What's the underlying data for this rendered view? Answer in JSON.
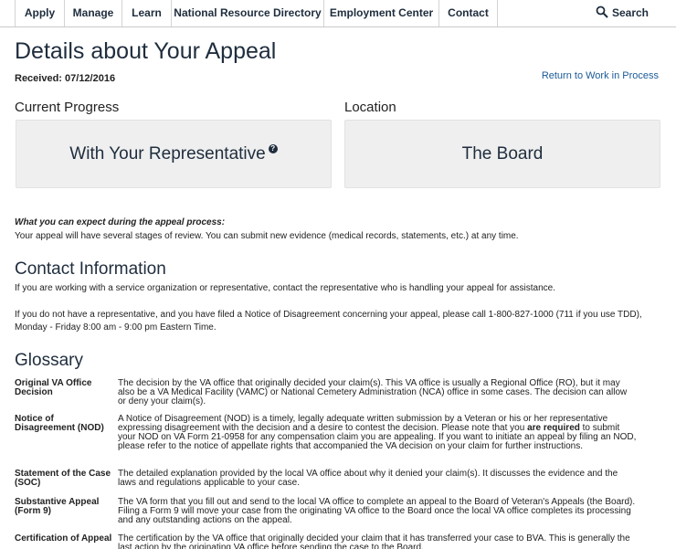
{
  "nav": {
    "items": [
      {
        "label": "Apply"
      },
      {
        "label": "Manage"
      },
      {
        "label": "Learn"
      },
      {
        "label": "National Resource Directory"
      },
      {
        "label": "Employment Center"
      },
      {
        "label": "Contact"
      }
    ],
    "search_label": "Search"
  },
  "page": {
    "title": "Details about Your Appeal",
    "received": "Received: 07/12/2016",
    "return_link": "Return to Work in Process"
  },
  "progress": {
    "heading": "Current Progress",
    "value": "With Your Representative",
    "help_glyph": "?"
  },
  "location": {
    "heading": "Location",
    "value": "The Board"
  },
  "expect": {
    "title": "What you can expect during the appeal process:",
    "text": "Your appeal will have several stages of review. You can submit new evidence (medical records, statements, etc.) at any time."
  },
  "contact": {
    "title": "Contact Information",
    "para1": "If you are working with a service organization or representative, contact the representative who is handling your appeal for assistance.",
    "para2": "If you do not have a representative, and you have filed a Notice of Disagreement concerning your appeal, please call 1-800-827-1000 (711 if you use TDD), Monday - Friday 8:00 am - 9:00 pm Eastern Time."
  },
  "glossary": {
    "title": "Glossary",
    "entries": [
      {
        "term": "Original VA Office Decision",
        "definition": "The decision by the VA office that originally decided your claim(s). This VA office is usually a Regional Office (RO), but it may also be a VA Medical Facility (VAMC) or National Cemetery Administration (NCA) office in some cases. The decision can allow or deny your claim(s)."
      },
      {
        "term": "Notice of Disagreement (NOD)",
        "definition_before": "A Notice of Disagreement (NOD) is a timely, legally adequate written submission by a Veteran or his or her representative expressing disagreement with the decision and a desire to contest the decision. Please note that you ",
        "definition_bold": "are required",
        "definition_after": " to submit your NOD on VA Form 21-0958 for any compensation claim you are appealing. If you want to initiate an appeal by filing an NOD, please refer to the notice of appellate rights that accompanied the VA decision on your claim for further instructions."
      },
      {
        "term": "Statement of the Case (SOC)",
        "definition": "The detailed explanation provided by the local VA office about why it denied your claim(s). It discusses the evidence and the laws and regulations applicable to your case."
      },
      {
        "term": "Substantive Appeal (Form 9)",
        "definition": "The VA form that you fill out and send to the local VA office to complete an appeal to the Board of Veteran's Appeals (the Board). Filing a Form 9 will move your case from the originating VA office to the Board once the local VA office completes its processing and any outstanding actions on the appeal."
      },
      {
        "term": "Certification of Appeal",
        "definition": "The certification by the VA office that originally decided your claim that it has transferred your case to BVA. This is generally the last action by the originating VA office before sending the case to the Board."
      }
    ]
  }
}
